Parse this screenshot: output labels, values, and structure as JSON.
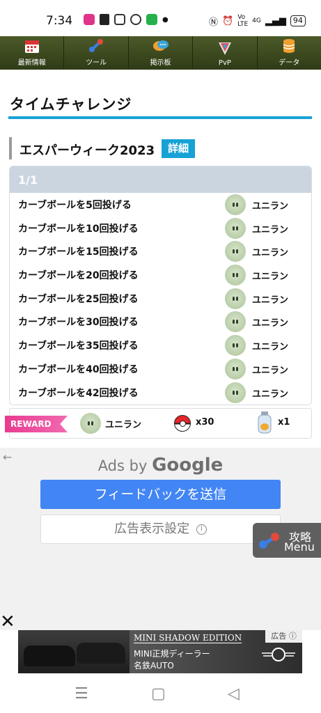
{
  "status": {
    "time": "7:34",
    "battery": "94",
    "network": "4G"
  },
  "nav": [
    {
      "label": "最新情報",
      "icon": "calendar-icon"
    },
    {
      "label": "ツール",
      "icon": "tools-icon"
    },
    {
      "label": "掲示板",
      "icon": "chat-icon"
    },
    {
      "label": "PvP",
      "icon": "pvp-icon"
    },
    {
      "label": "データ",
      "icon": "database-icon"
    }
  ],
  "page": {
    "title": "タイムチャレンジ"
  },
  "event": {
    "title": "エスパーウィーク2023",
    "detail_label": "詳細"
  },
  "tasks": {
    "header": "1/1",
    "rows": [
      {
        "task": "カーブボールを5回投げる",
        "reward": "ユニラン"
      },
      {
        "task": "カーブボールを10回投げる",
        "reward": "ユニラン"
      },
      {
        "task": "カーブボールを15回投げる",
        "reward": "ユニラン"
      },
      {
        "task": "カーブボールを20回投げる",
        "reward": "ユニラン"
      },
      {
        "task": "カーブボールを25回投げる",
        "reward": "ユニラン"
      },
      {
        "task": "カーブボールを30回投げる",
        "reward": "ユニラン"
      },
      {
        "task": "カーブボールを35回投げる",
        "reward": "ユニラン"
      },
      {
        "task": "カーブボールを40回投げる",
        "reward": "ユニラン"
      },
      {
        "task": "カーブボールを42回投げる",
        "reward": "ユニラン"
      }
    ]
  },
  "reward": {
    "tag": "REWARD",
    "pokemon": "ユニラン",
    "ball_count": "x30",
    "potion_count": "x1"
  },
  "ads": {
    "ads_by": "Ads by",
    "google": "Google",
    "feedback": "フィードバックを送信",
    "settings": "広告表示設定",
    "info_icon": "i"
  },
  "menu_button": {
    "line1": "攻略",
    "line2": "Menu"
  },
  "banner": {
    "close": "✕",
    "title": "MINI SHADOW EDITION",
    "line2": "MINI正規ディーラー",
    "line3": "名鉄AUTO",
    "ad_label": "広告 ⓘ"
  },
  "system_nav": {
    "recents": "☰",
    "home": "▢",
    "back": "◁"
  }
}
